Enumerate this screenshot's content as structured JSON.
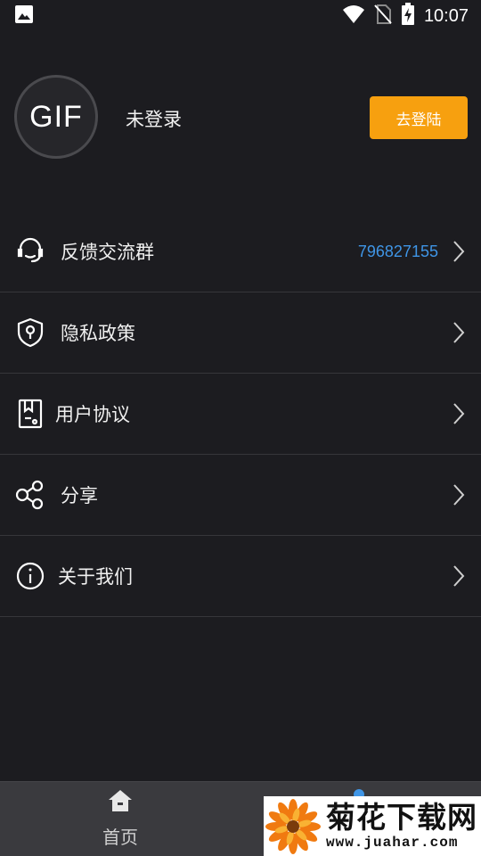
{
  "status_bar": {
    "time": "10:07",
    "icons": [
      "image-icon",
      "wifi-icon",
      "no-sim-icon",
      "battery-charging-icon"
    ]
  },
  "profile": {
    "avatar_text": "GIF",
    "username": "未登录",
    "login_label": "去登陆"
  },
  "menu": {
    "items": [
      {
        "label": "反馈交流群",
        "value": "796827155",
        "icon": "headset-icon"
      },
      {
        "label": "隐私政策",
        "icon": "shield-icon"
      },
      {
        "label": "用户协议",
        "icon": "document-icon"
      },
      {
        "label": "分享",
        "icon": "share-icon"
      },
      {
        "label": "关于我们",
        "icon": "info-icon"
      }
    ]
  },
  "tabbar": {
    "home_label": "首页"
  },
  "watermark": {
    "title": "菊花下载网",
    "url": "www.juahar.com"
  },
  "colors": {
    "background": "#1c1c20",
    "accent": "#f7a00f",
    "link": "#3f95e6",
    "tabbar": "#3a3a3e"
  }
}
